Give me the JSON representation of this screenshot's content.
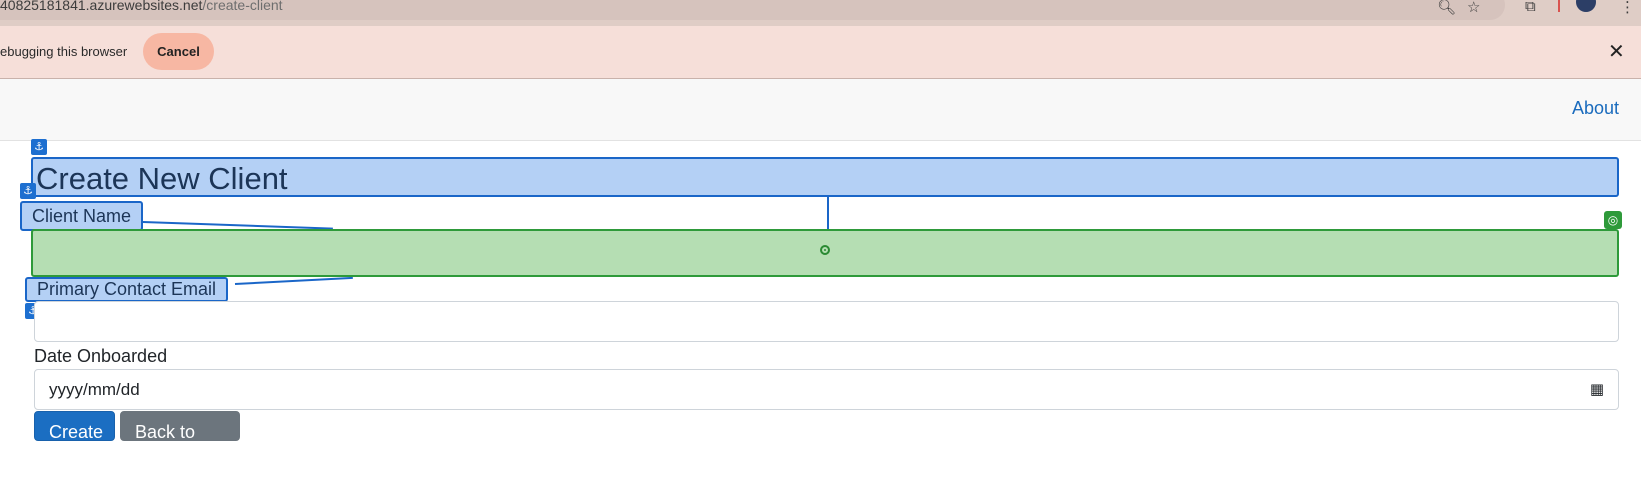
{
  "browser": {
    "url_host": "40825181841.azurewebsites.net",
    "url_path": "/create-client"
  },
  "infobar": {
    "message": "ebugging this browser",
    "cancel_label": "Cancel",
    "close_label": "✕"
  },
  "navbar": {
    "about_label": "About"
  },
  "form": {
    "title": "Create New Client",
    "client_name_label": "Client Name",
    "email_label": "Primary Contact Email",
    "date_label": "Date Onboarded",
    "date_placeholder": "yyyy/mm/dd",
    "create_label": "Create",
    "back_label": "Back to List"
  },
  "icons": {
    "anchor": "anchor-icon",
    "target": "target-icon",
    "calendar": "calendar-icon",
    "zoom": "zoom-icon",
    "star": "star-icon",
    "extensions": "extensions-icon",
    "menu": "menu-icon"
  },
  "colors": {
    "overlay_blue": "#b4d0f5",
    "overlay_green": "#b5deb3",
    "primary": "#1b6ec2",
    "secondary": "#6c757d",
    "infobar": "#f6dfd9"
  }
}
